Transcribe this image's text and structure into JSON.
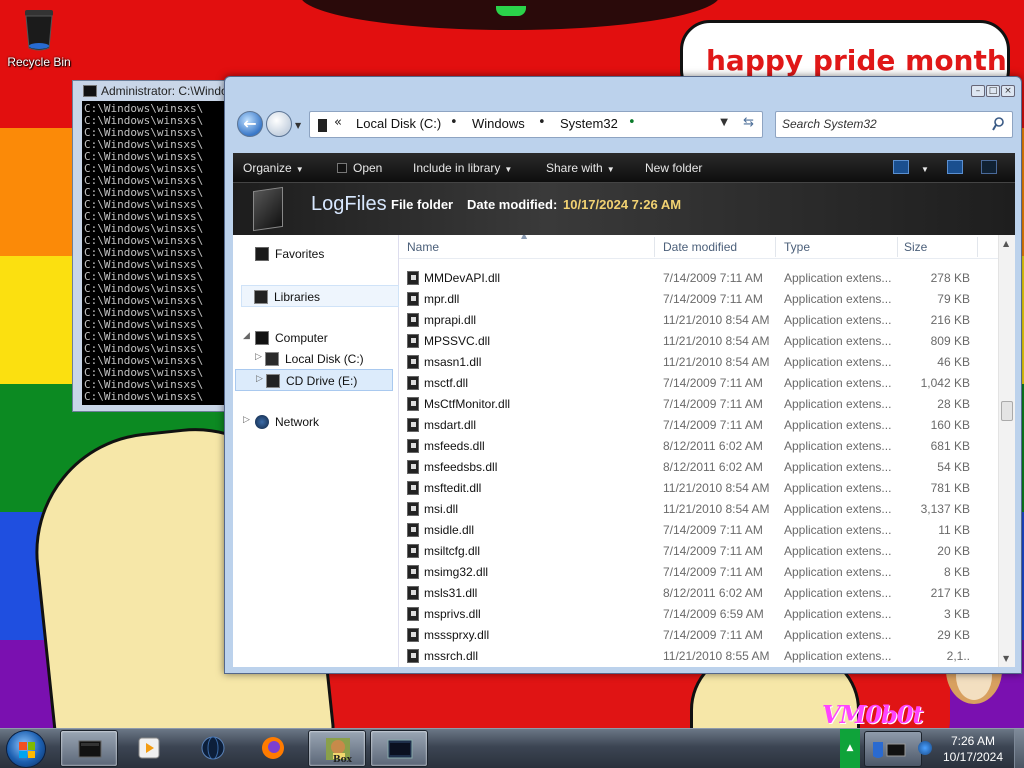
{
  "desktop": {
    "recycle_bin_label": "Recycle Bin",
    "wallpaper_text": "happy pride month",
    "watermark": "VM0b0t"
  },
  "cmd": {
    "title": "Administrator: C:\\Windo",
    "lines": [
      "C:\\Windows\\winsxs\\",
      "C:\\Windows\\winsxs\\",
      "C:\\Windows\\winsxs\\",
      "C:\\Windows\\winsxs\\",
      "C:\\Windows\\winsxs\\",
      "C:\\Windows\\winsxs\\",
      "C:\\Windows\\winsxs\\",
      "C:\\Windows\\winsxs\\",
      "C:\\Windows\\winsxs\\",
      "C:\\Windows\\winsxs\\",
      "C:\\Windows\\winsxs\\",
      "C:\\Windows\\winsxs\\",
      "C:\\Windows\\winsxs\\",
      "C:\\Windows\\winsxs\\",
      "C:\\Windows\\winsxs\\",
      "C:\\Windows\\winsxs\\",
      "C:\\Windows\\winsxs\\",
      "C:\\Windows\\winsxs\\",
      "C:\\Windows\\winsxs\\",
      "C:\\Windows\\winsxs\\",
      "C:\\Windows\\winsxs\\",
      "C:\\Windows\\winsxs\\",
      "C:\\Windows\\winsxs\\",
      "C:\\Windows\\winsxs\\",
      "C:\\Windows\\winsxs\\"
    ]
  },
  "explorer": {
    "address": {
      "crumbs": [
        "Local Disk (C:)",
        "Windows",
        "System32"
      ],
      "sep_root": "«",
      "sep": "•"
    },
    "search_placeholder": "Search System32",
    "toolbar": {
      "organize": "Organize",
      "open": "Open",
      "include_in_library": "Include in library",
      "share_with": "Share with",
      "new_folder": "New folder"
    },
    "details": {
      "name": "LogFiles",
      "type": "File folder",
      "modified_label": "Date modified:",
      "modified_value": "10/17/2024 7:26 AM"
    },
    "nav": {
      "favorites": "Favorites",
      "libraries": "Libraries",
      "computer": "Computer",
      "local_disk": "Local Disk (C:)",
      "cd_drive": "CD Drive (E:)",
      "network": "Network"
    },
    "columns": {
      "name": "Name",
      "date": "Date modified",
      "type": "Type",
      "size": "Size"
    },
    "files": [
      {
        "name": "MMDevAPI.dll",
        "date": "7/14/2009 7:11 AM",
        "type": "Application extens...",
        "size": "278 KB"
      },
      {
        "name": "mpr.dll",
        "date": "7/14/2009 7:11 AM",
        "type": "Application extens...",
        "size": "79 KB"
      },
      {
        "name": "mprapi.dll",
        "date": "11/21/2010 8:54 AM",
        "type": "Application extens...",
        "size": "216 KB"
      },
      {
        "name": "MPSSVC.dll",
        "date": "11/21/2010 8:54 AM",
        "type": "Application extens...",
        "size": "809 KB"
      },
      {
        "name": "msasn1.dll",
        "date": "11/21/2010 8:54 AM",
        "type": "Application extens...",
        "size": "46 KB"
      },
      {
        "name": "msctf.dll",
        "date": "7/14/2009 7:11 AM",
        "type": "Application extens...",
        "size": "1,042 KB"
      },
      {
        "name": "MsCtfMonitor.dll",
        "date": "7/14/2009 7:11 AM",
        "type": "Application extens...",
        "size": "28 KB"
      },
      {
        "name": "msdart.dll",
        "date": "7/14/2009 7:11 AM",
        "type": "Application extens...",
        "size": "160 KB"
      },
      {
        "name": "msfeeds.dll",
        "date": "8/12/2011 6:02 AM",
        "type": "Application extens...",
        "size": "681 KB"
      },
      {
        "name": "msfeedsbs.dll",
        "date": "8/12/2011 6:02 AM",
        "type": "Application extens...",
        "size": "54 KB"
      },
      {
        "name": "msftedit.dll",
        "date": "11/21/2010 8:54 AM",
        "type": "Application extens...",
        "size": "781 KB"
      },
      {
        "name": "msi.dll",
        "date": "11/21/2010 8:54 AM",
        "type": "Application extens...",
        "size": "3,137 KB"
      },
      {
        "name": "msidle.dll",
        "date": "7/14/2009 7:11 AM",
        "type": "Application extens...",
        "size": "11 KB"
      },
      {
        "name": "msiltcfg.dll",
        "date": "7/14/2009 7:11 AM",
        "type": "Application extens...",
        "size": "20 KB"
      },
      {
        "name": "msimg32.dll",
        "date": "7/14/2009 7:11 AM",
        "type": "Application extens...",
        "size": "8 KB"
      },
      {
        "name": "msls31.dll",
        "date": "8/12/2011 6:02 AM",
        "type": "Application extens...",
        "size": "217 KB"
      },
      {
        "name": "msprivs.dll",
        "date": "7/14/2009 6:59 AM",
        "type": "Application extens...",
        "size": "3 KB"
      },
      {
        "name": "msssprxy.dll",
        "date": "7/14/2009 7:11 AM",
        "type": "Application extens...",
        "size": "29 KB"
      },
      {
        "name": "mssrch.dll",
        "date": "11/21/2010 8:55 AM",
        "type": "Application extens...",
        "size": "2,1.."
      }
    ]
  },
  "taskbar": {
    "clock_time": "7:26 AM",
    "clock_date": "10/17/2024",
    "pinned": [
      "explorer-icon",
      "media-player-icon",
      "globe-icon",
      "firefox-icon",
      "box-app-icon",
      "cmd-icon"
    ],
    "box_app_label": "Box"
  },
  "colors": {
    "accent": "#1c5fb0",
    "tray_green": "#0fa33a",
    "detail_date": "#f2d272"
  }
}
